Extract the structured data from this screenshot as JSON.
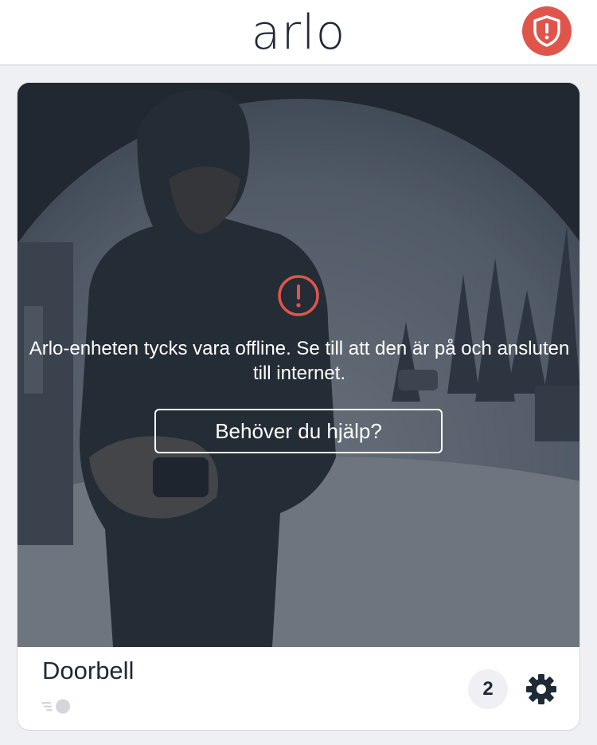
{
  "header": {
    "logo_text": "arlo",
    "security_icon": "shield-exclamation-icon",
    "accent_color": "#e0554b"
  },
  "card": {
    "feed": {
      "status_icon": "exclamation-circle-icon",
      "offline_message": "Arlo-enheten tycks vara offline. Se till att den är på och ansluten till internet.",
      "help_button_label": "Behöver du hjälp?"
    },
    "device_name": "Doorbell",
    "mode_icon": "motion-toggle-icon",
    "notification_count": "2",
    "settings_icon": "gear-icon"
  }
}
